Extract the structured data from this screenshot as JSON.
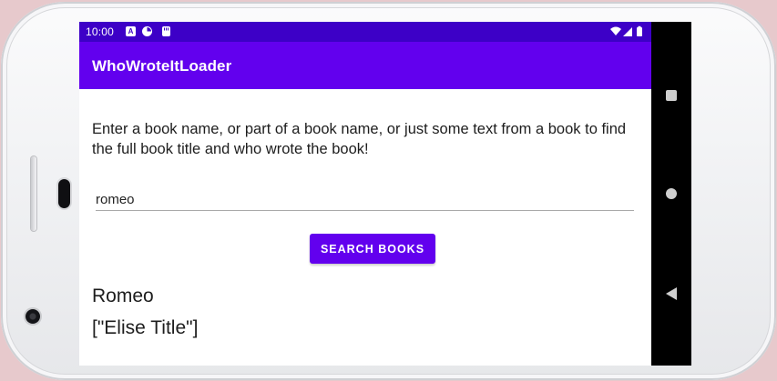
{
  "status_bar": {
    "time": "10:00",
    "icons": [
      "a-notification-icon",
      "data-saver-icon",
      "sd-card-icon"
    ],
    "right_icons": [
      "wifi-icon",
      "cell-signal-icon",
      "battery-icon"
    ]
  },
  "app_bar": {
    "title": "WhoWroteItLoader"
  },
  "main": {
    "instructions": "Enter a book name, or part of a book name, or just some text from a book to find the full book title and who wrote the book!",
    "book_input_value": "romeo",
    "search_button_label": "SEARCH BOOKS",
    "result_title": "Romeo",
    "result_authors": "[\"Elise Title\"]"
  },
  "nav_bar": {
    "buttons": [
      "recent-apps",
      "home",
      "back"
    ]
  },
  "colors": {
    "status_bar": "#3d00c7",
    "primary": "#6200ee",
    "nav_bar": "#000000",
    "background": "#ffffff"
  }
}
